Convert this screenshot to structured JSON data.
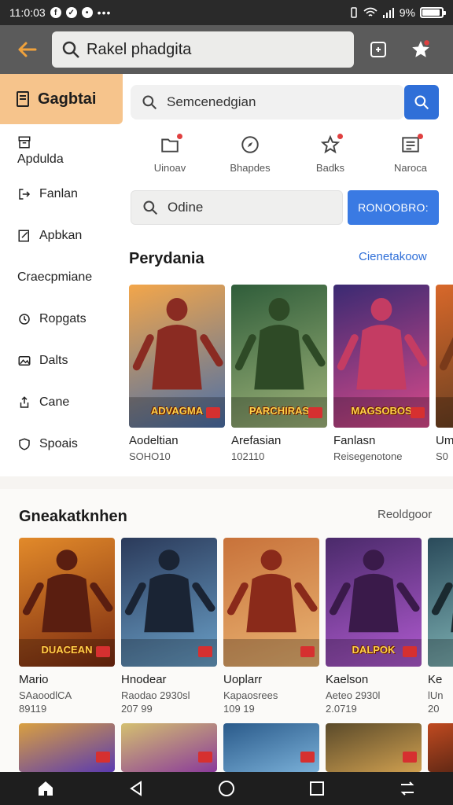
{
  "status_bar": {
    "time": "11:0:03",
    "signal_text": "9%",
    "battery_level": 0.9
  },
  "app_bar": {
    "search_text": "Rakel phadgita"
  },
  "sidebar": {
    "header": "Gagbtai",
    "items": [
      {
        "label": "Apdulda",
        "icon": "archive-icon"
      },
      {
        "label": "Fanlan",
        "icon": "login-icon"
      },
      {
        "label": "Apbkan",
        "icon": "edit-icon"
      },
      {
        "label": "Craecpmiane",
        "icon": ""
      },
      {
        "label": "Ropgats",
        "icon": "clock-icon"
      },
      {
        "label": "Dalts",
        "icon": "image-icon"
      },
      {
        "label": "Cane",
        "icon": "share-icon"
      },
      {
        "label": "Spoais",
        "icon": "shield-icon"
      }
    ]
  },
  "main": {
    "search_placeholder": "Semcenedgian",
    "categories": [
      {
        "label": "Uinoav",
        "icon": "folder-icon"
      },
      {
        "label": "Bhapdes",
        "icon": "compass-icon"
      },
      {
        "label": "Badks",
        "icon": "star-icon"
      },
      {
        "label": "Naroca",
        "icon": "list-icon"
      }
    ],
    "filter_text": "Odine",
    "filter_button": "RONOOBRO:"
  },
  "section1": {
    "title": "Perydania",
    "link": "Cienetakoow",
    "cards": [
      {
        "name": "Aodeltian",
        "sub": "SOHO10",
        "art": "ADVAGMA",
        "c1": "#f3a64a",
        "c2": "#4a6fa8",
        "fig": "#8a2b22"
      },
      {
        "name": "Arefasian",
        "sub": "102110",
        "art": "PARCHIRAS",
        "c1": "#2f5d3a",
        "c2": "#a0b47a",
        "fig": "#2e4a26"
      },
      {
        "name": "Fanlasn",
        "sub": "Reisegenotone",
        "art": "MAGSOBOS",
        "c1": "#3a2a72",
        "c2": "#d94a8a",
        "fig": "#c43c63"
      },
      {
        "name": "Um",
        "sub": "S0",
        "art": "",
        "c1": "#d8682a",
        "c2": "#5a3a20",
        "fig": "#7a3a1a"
      }
    ]
  },
  "section2": {
    "title": "Gneakatknhen",
    "link": "Reoldgoor",
    "cards": [
      {
        "name": "Mario",
        "sub": "SAaoodlCA",
        "sub2": "89119",
        "art": "DUACEAN",
        "c1": "#e28a2a",
        "c2": "#7a2a10",
        "fig": "#5a1e10"
      },
      {
        "name": "Hnodear",
        "sub": "Raodao 2930sl",
        "sub2": "207 99",
        "art": "",
        "c1": "#2b3a5a",
        "c2": "#6aa0c8",
        "fig": "#1a2434"
      },
      {
        "name": "Uoplarr",
        "sub": "Kapaosrees",
        "sub2": "109 19",
        "art": "",
        "c1": "#c8723a",
        "c2": "#eab574",
        "fig": "#8a2a1a"
      },
      {
        "name": "Kaelson",
        "sub": "Aeteo 2930l",
        "sub2": "2.0719",
        "art": "DALPOK",
        "c1": "#4a2a6a",
        "c2": "#b05ad0",
        "fig": "#3a1a4a"
      },
      {
        "name": "Ke",
        "sub": "lUn",
        "sub2": "20",
        "art": "",
        "c1": "#2a4a5a",
        "c2": "#8ac0c0",
        "fig": "#1a2a30"
      }
    ]
  },
  "section3": {
    "cards": [
      {
        "c1": "#d9a040",
        "c2": "#5a3ab0"
      },
      {
        "c1": "#d4c070",
        "c2": "#8a3a9a"
      },
      {
        "c1": "#2a5a8a",
        "c2": "#7ab0d8"
      },
      {
        "c1": "#5a4a2a",
        "c2": "#d0a050"
      },
      {
        "c1": "#c04a20",
        "c2": "#3a1a10"
      }
    ]
  }
}
